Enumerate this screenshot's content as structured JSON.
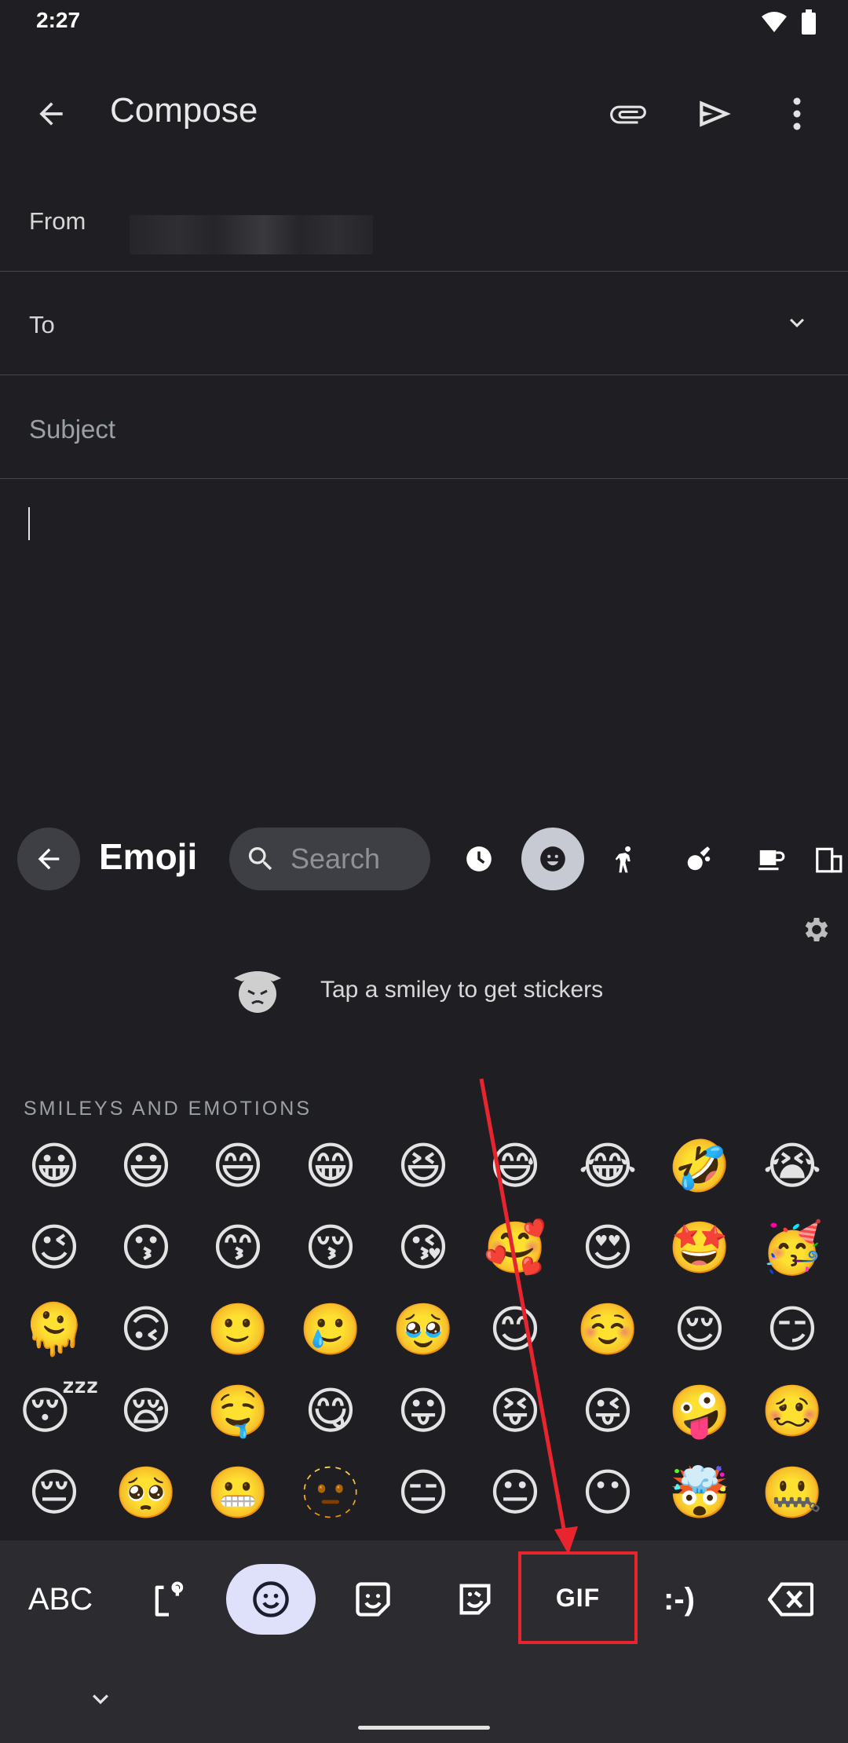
{
  "status": {
    "time": "2:27",
    "wifi_icon": "wifi-icon",
    "battery_icon": "battery-icon"
  },
  "app_bar": {
    "title": "Compose",
    "back_icon": "arrow-back-icon",
    "attach_icon": "paperclip-icon",
    "send_icon": "send-icon",
    "more_icon": "more-vert-icon"
  },
  "fields": {
    "from_label": "From",
    "to_label": "To",
    "subject_placeholder": "Subject"
  },
  "keyboard": {
    "title": "Emoji",
    "search_placeholder": "Search",
    "categories": [
      "recent-icon",
      "smileys-icon",
      "people-icon",
      "activities-icon",
      "food-icon",
      "places-icon"
    ],
    "sticker_hint": "Tap a smiley to get stickers",
    "section_label": "SMILEYS AND EMOTIONS",
    "emojis": [
      [
        "😀",
        "😃",
        "😄",
        "😁",
        "😆",
        "😅",
        "😂",
        "🤣",
        "😭"
      ],
      [
        "😉",
        "😗",
        "😙",
        "😚",
        "😘",
        "🥰",
        "😍",
        "🤩",
        "🥳"
      ],
      [
        "🫠",
        "🙃",
        "🙂",
        "🥲",
        "🥹",
        "😊",
        "☺️",
        "😌",
        "😏"
      ],
      [
        "😴",
        "😪",
        "🤤",
        "😋",
        "😛",
        "😝",
        "😜",
        "🤪",
        "🥴"
      ],
      [
        "😔",
        "🥺",
        "😬",
        "🫥",
        "😑",
        "😐",
        "😶",
        "🤯",
        "🤐"
      ]
    ],
    "bottom": {
      "abc_label": "ABC",
      "gif_label": "GIF",
      "emoticon_label": ":-)"
    },
    "highlight_color": "#e8252f"
  }
}
